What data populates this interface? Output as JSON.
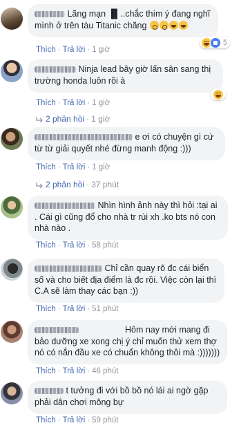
{
  "labels": {
    "like": "Thích",
    "reply": "Trả lời"
  },
  "colors": {
    "link": "#4267b2",
    "meta": "#90949c",
    "bubble": "#f2f3f5"
  },
  "comments": [
    {
      "text": "Lãng mạn ▐▌..chắc thím ý đang nghĩ mình ở trên tàu Titanic chăng",
      "time": "1 giờ",
      "inline_emojis": [
        "open-mouth-emoji",
        "open-mouth-emoji",
        "laugh-emoji",
        "laugh-emoji"
      ],
      "reactions": {
        "icons": [
          "haha-icon",
          "like-icon"
        ],
        "count": "5"
      }
    },
    {
      "text": "Ninja lead bây giờ lấn sân sang thị trường honda luôn rồi à",
      "time": "1 giờ",
      "reactions": {
        "icons": [
          "haha-icon"
        ],
        "count": ""
      },
      "replies": {
        "label": "2 phản hồi",
        "time": "1 giờ"
      }
    },
    {
      "text": "e ơi có chuyện gì cứ từ từ giải quyết nhé đừng manh động :)))",
      "time": "1 giờ",
      "replies": {
        "label": "2 phản hồi",
        "time": "37 phút"
      }
    },
    {
      "text": "Nhìn hình ảnh này thì hỏi :tại ai . Cái gì cũng đổ cho nhà tr rùi xh .ko bts nó con nhà nào .",
      "time": "58 phút"
    },
    {
      "text": "Chỉ cần quay rõ đc cái biển số và cho biết địa điểm là đc rồi. Việc còn lại thì C.A sẽ làm thay các bạn :))",
      "time": "51 phút"
    },
    {
      "text": "Hôm nay mới mang đi bảo dưỡng xe xong chị ý chỉ muốn thử xem thợ nó có nắn đầu xe có chuẩn không thôi mà :)))))))",
      "time": "46 phút"
    },
    {
      "text": "t tưởng đi với bồ bồ nó lái ai ngờ gặp phải dân chơi mông bự",
      "time": "59 phút"
    }
  ]
}
